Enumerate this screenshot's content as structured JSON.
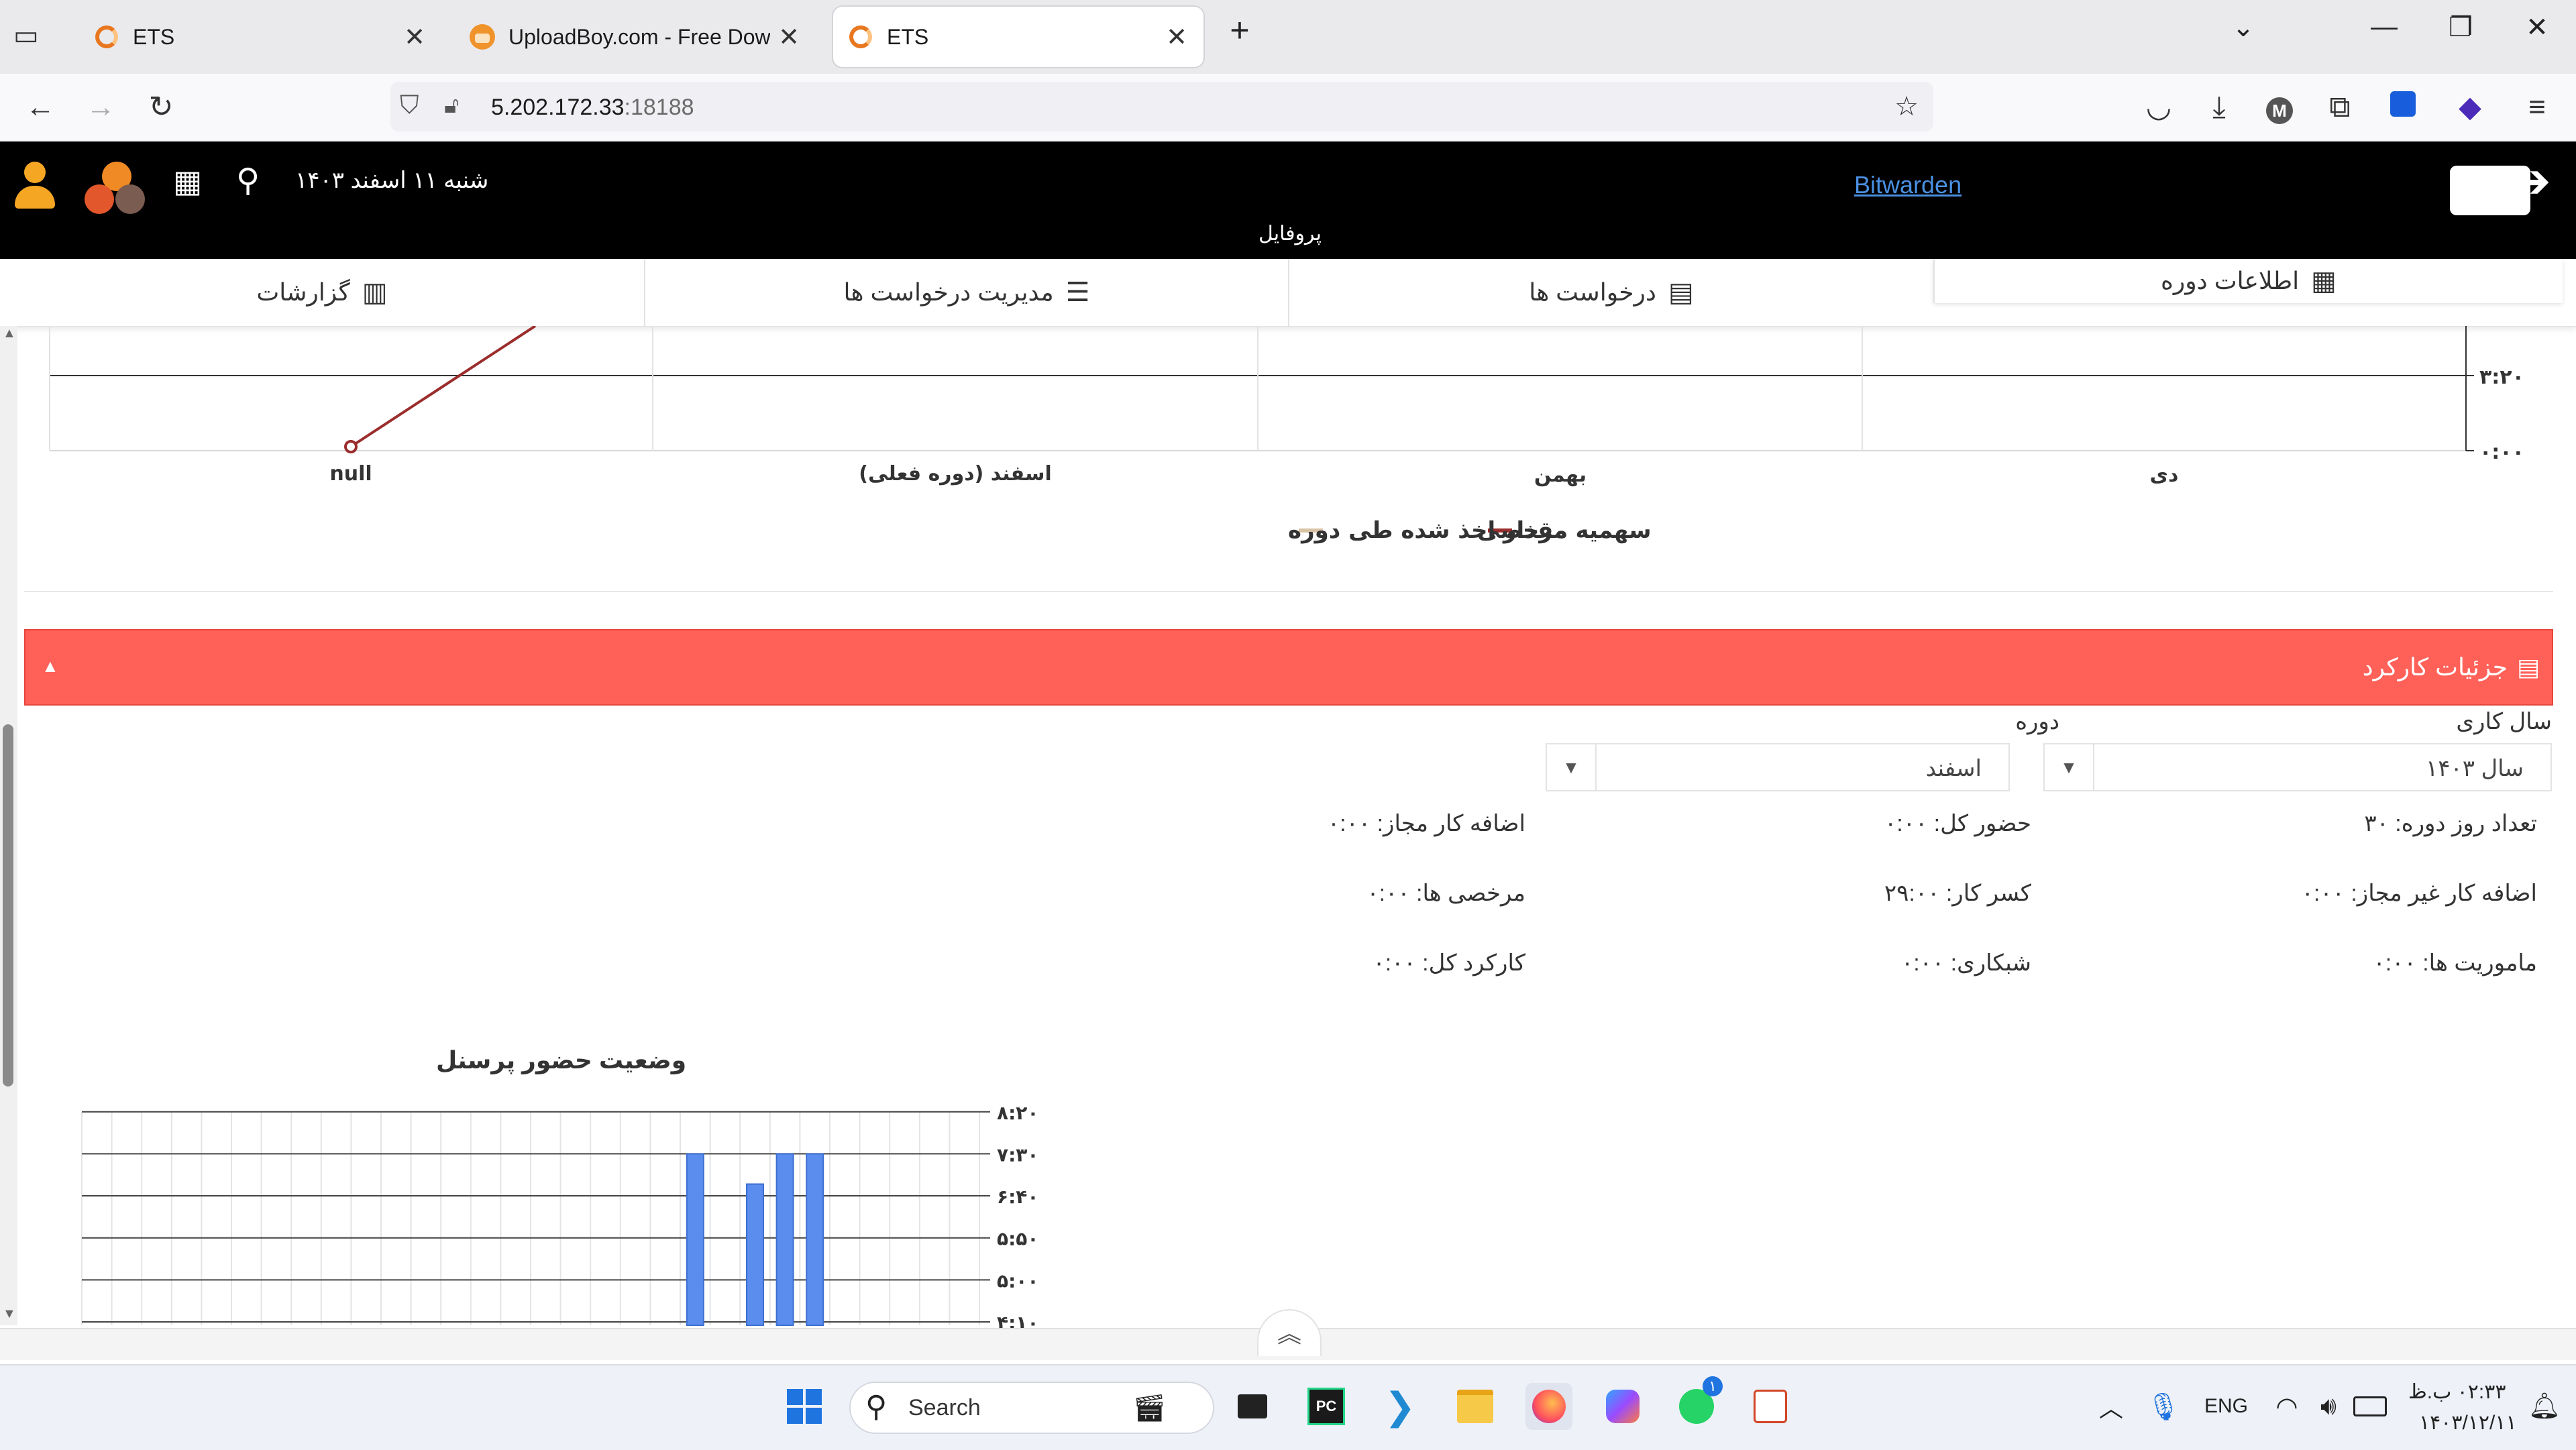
{
  "browser": {
    "tabs": [
      {
        "title": "ETS",
        "active": false
      },
      {
        "title": "UploadBoy.com - Free Downloa",
        "active": false
      },
      {
        "title": "ETS",
        "active": true
      }
    ],
    "url_host": "5.202.172.33",
    "url_port": ":18188"
  },
  "header": {
    "date": "شنبه ۱۱ اسفند ۱۴۰۳",
    "bitwarden": "Bitwarden",
    "profile": "پروفایل"
  },
  "menu": [
    {
      "label": "اطلاعات دوره",
      "icon": "calendar-icon"
    },
    {
      "label": "درخواست ها",
      "icon": "list-icon"
    },
    {
      "label": "مدیریت درخواست ها",
      "icon": "tasks-icon"
    },
    {
      "label": "گزارشات",
      "icon": "report-icon"
    }
  ],
  "leave_chart": {
    "y_ticks": [
      "۳:۲۰",
      "۰:۰۰"
    ],
    "categories": [
      "دی",
      "بهمن",
      "اسفند (دوره فعلی)",
      "null"
    ],
    "legend": [
      "سهمیه مرخصی",
      "مقدار اخذ شده طی دوره"
    ],
    "colors": {
      "quota": "#9b2d2d",
      "taken": "#d8c3a5"
    }
  },
  "details_panel": {
    "title": "جزئیات کارکرد",
    "collapse_icon": "▲",
    "year_label": "سال کاری",
    "year_value": "سال ۱۴۰۳",
    "period_label": "دوره",
    "period_value": "اسفند",
    "stats": {
      "days": "تعداد روز دوره: ۳۰",
      "attendance": "حضور کل: ۰:۰۰",
      "overtime_ok": "اضافه کار مجاز: ۰:۰۰",
      "overtime_bad": "اضافه کار غیر مجاز: ۰:۰۰",
      "deficit": "کسر کار: ۲۹:۰۰",
      "leaves": "مرخصی ها: ۰:۰۰",
      "missions": "ماموریت ها: ۰:۰۰",
      "night": "شبکاری: ۰:۰۰",
      "total": "کارکرد کل: ۰:۰۰"
    }
  },
  "chart_data": [
    {
      "type": "line",
      "categories": [
        "دی",
        "بهمن",
        "اسفند (دوره فعلی)",
        "null"
      ],
      "series": [
        {
          "name": "سهمیه مرخصی"
        },
        {
          "name": "مقدار اخذ شده طی دوره"
        }
      ],
      "y_ticks": [
        "۰:۰۰",
        "۳:۲۰"
      ],
      "legend_position": "bottom",
      "grid": true
    },
    {
      "type": "bar",
      "title": "وضعیت حضور پرسنل",
      "y_ticks": [
        "۴:۱۰",
        "۵:۰۰",
        "۵:۵۰",
        "۶:۴۰",
        "۷:۳۰",
        "۸:۲۰"
      ],
      "ylim": [
        4.1,
        8.33
      ],
      "bars": [
        {
          "slot": 20,
          "value": 7.5
        },
        {
          "slot": 22,
          "value": 6.9
        },
        {
          "slot": 23,
          "value": 7.5
        },
        {
          "slot": 24,
          "value": 7.5
        }
      ],
      "slots": 30,
      "color": "#5b8def",
      "grid": true
    }
  ],
  "taskbar": {
    "search": "Search",
    "lang": "ENG",
    "time": "۰۲:۳۳ ب.ظ",
    "date": "۱۴۰۳/۱۲/۱۱",
    "whatsapp_badge": "۱"
  }
}
